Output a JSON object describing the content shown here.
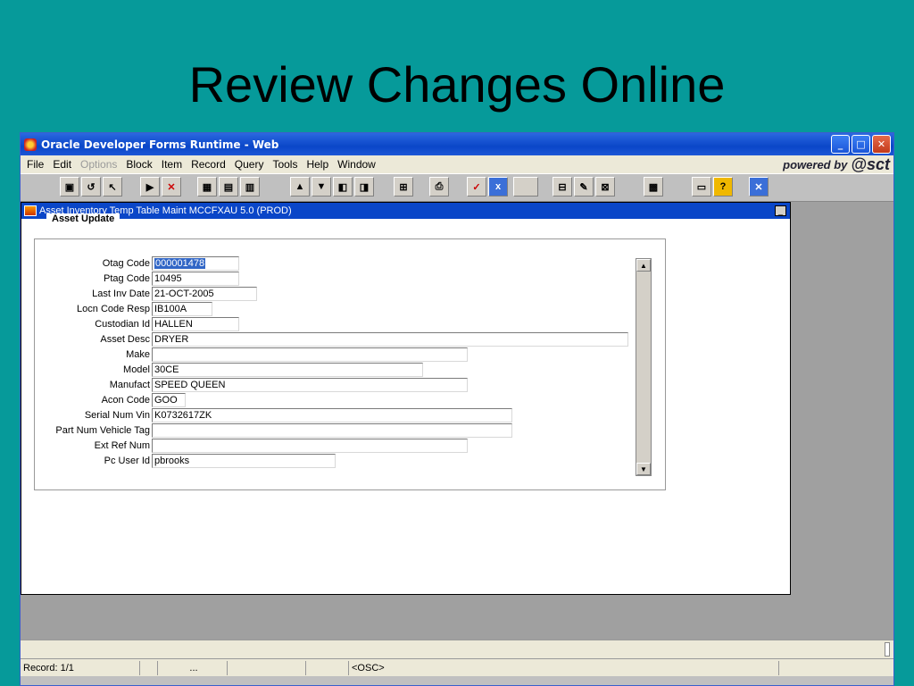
{
  "slide": {
    "title": "Review Changes Online"
  },
  "window": {
    "title": "Oracle Developer Forms Runtime - Web",
    "controls": {
      "minimize": "_",
      "maximize": "□",
      "close": "✕"
    }
  },
  "menu": [
    {
      "label": "File",
      "disabled": false
    },
    {
      "label": "Edit",
      "disabled": false
    },
    {
      "label": "Options",
      "disabled": true
    },
    {
      "label": "Block",
      "disabled": false
    },
    {
      "label": "Item",
      "disabled": false
    },
    {
      "label": "Record",
      "disabled": false
    },
    {
      "label": "Query",
      "disabled": false
    },
    {
      "label": "Tools",
      "disabled": false
    },
    {
      "label": "Help",
      "disabled": false
    },
    {
      "label": "Window",
      "disabled": false
    }
  ],
  "branding": {
    "powered_by": "powered by",
    "logo": "@sct"
  },
  "form": {
    "title": "Asset Inventory Temp Table Maint  MCCFXAU  5.0  (PROD)",
    "minimize": "_",
    "group_label": "Asset Update",
    "fields": [
      {
        "label": "Otag Code",
        "value": "000001478",
        "selected": true
      },
      {
        "label": "Ptag Code",
        "value": "10495"
      },
      {
        "label": "Last Inv Date",
        "value": "21-OCT-2005"
      },
      {
        "label": "Locn Code Resp",
        "value": "IB100A"
      },
      {
        "label": "Custodian Id",
        "value": "HALLEN"
      },
      {
        "label": "Asset Desc",
        "value": "DRYER"
      },
      {
        "label": "Make",
        "value": ""
      },
      {
        "label": "Model",
        "value": "30CE"
      },
      {
        "label": "Manufact",
        "value": "SPEED QUEEN"
      },
      {
        "label": "Acon Code",
        "value": "GOO"
      },
      {
        "label": "Serial Num Vin",
        "value": "K0732617ZK"
      },
      {
        "label": "Part Num Vehicle Tag",
        "value": ""
      },
      {
        "label": "Ext Ref Num",
        "value": ""
      },
      {
        "label": "Pc User Id",
        "value": "pbrooks"
      }
    ],
    "scroll": {
      "up": "▲",
      "down": "▼"
    }
  },
  "status": {
    "record": "Record: 1/1",
    "ellipsis": "...",
    "mode": "<OSC>"
  }
}
